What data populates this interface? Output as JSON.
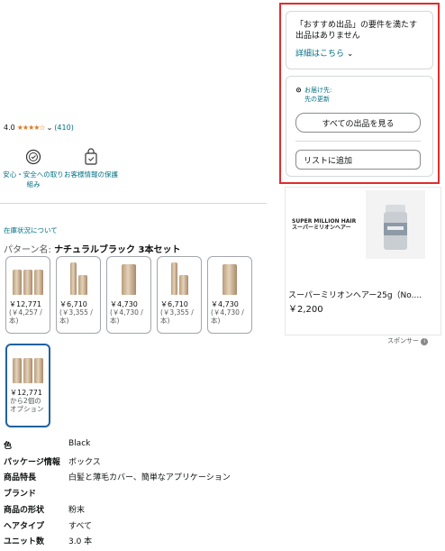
{
  "rating": {
    "value": "4.0",
    "stars": "★★★★☆",
    "count": "(410)"
  },
  "trust": [
    {
      "label": "安心・安全への取り組み"
    },
    {
      "label": "お客様情報の保護"
    }
  ],
  "stock_link": "在庫状況について",
  "pattern": {
    "label": "パターン名:",
    "value": "ナチュラルブラック 3本セット"
  },
  "swatches": [
    {
      "price": "￥12,771",
      "unit": "(￥4,257 / 本)"
    },
    {
      "price": "￥6,710",
      "unit": "(￥3,355 / 本)"
    },
    {
      "price": "￥4,730",
      "unit": "(￥4,730 / 本)"
    },
    {
      "price": "￥6,710",
      "unit": "(￥3,355 / 本)"
    },
    {
      "price": "￥4,730",
      "unit": "(￥4,730 / 本)"
    },
    {
      "price": "￥12,771",
      "unit": "から2個のオプション"
    }
  ],
  "attributes": [
    {
      "key": "色",
      "value": "Black"
    },
    {
      "key": "パッケージ情報",
      "value": "ボックス"
    },
    {
      "key": "商品特長",
      "value": "白髪と薄毛カバー、簡単なアプリケーション"
    },
    {
      "key": "ブランド",
      "value": ""
    },
    {
      "key": "商品の形状",
      "value": "粉末"
    },
    {
      "key": "ヘアタイプ",
      "value": "すべて"
    },
    {
      "key": "ユニット数",
      "value": "3.0 本"
    }
  ],
  "buybox": {
    "notice": "「おすすめ出品」の要件を満たす出品はありません",
    "detail_link": "詳細はこちら",
    "deliver_to": "お届け先:",
    "deliver_update": "先の更新",
    "see_all": "すべての出品を見る",
    "add_to_list": "リストに追加"
  },
  "ad": {
    "brand": "SUPER MILLION HAIR\nスーパーミリオンヘアー",
    "title": "スーパーミリオンヘアー25g（No....",
    "price": "￥2,200",
    "sponsor": "スポンサー"
  },
  "colors": {
    "link": "#007185",
    "star": "#de7921",
    "highlight": "#e02c2c",
    "selected": "#2162a1"
  }
}
